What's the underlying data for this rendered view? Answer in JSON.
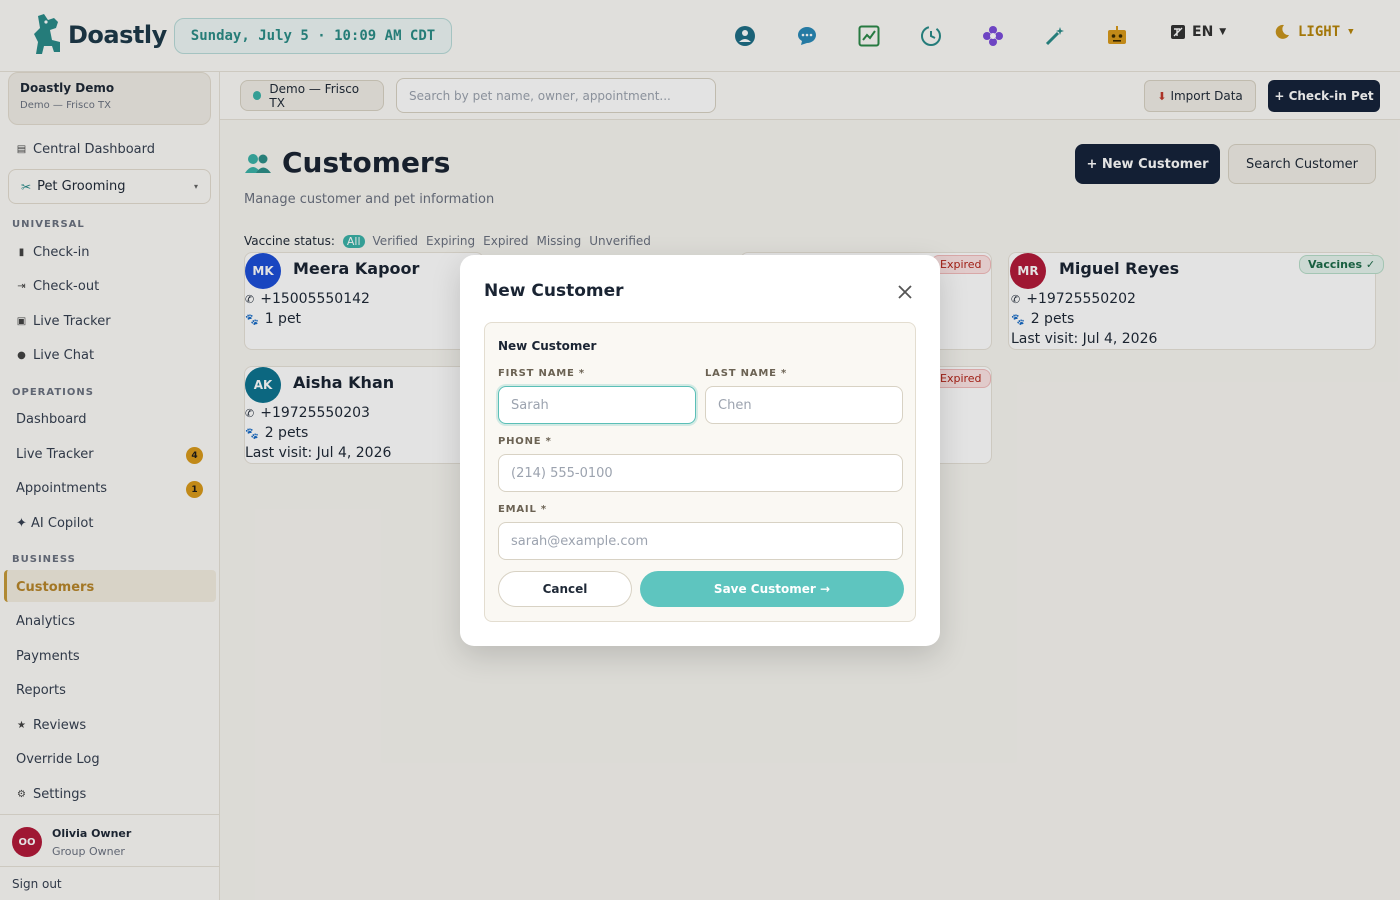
{
  "app": {
    "name": "Doastly"
  },
  "topbar": {
    "datetime": "Sunday, July 5 · 10:09 AM CDT",
    "language": "EN",
    "theme": "LIGHT",
    "icons": [
      "support-icon",
      "chat-icon",
      "analytics-icon",
      "history-icon",
      "flower-icon",
      "magic-wand-icon",
      "robot-icon"
    ]
  },
  "sidebar": {
    "org_name": "Doastly Demo",
    "org_sub": "Demo — Frisco TX",
    "central_dashboard": "Central Dashboard",
    "module": "Pet Grooming",
    "universal_label": "UNIVERSAL",
    "universal": [
      {
        "label": "Check-in"
      },
      {
        "label": "Check-out"
      },
      {
        "label": "Live Tracker"
      },
      {
        "label": "Live Chat"
      }
    ],
    "operations_label": "OPERATIONS",
    "operations": [
      {
        "label": "Dashboard"
      },
      {
        "label": "Live Tracker",
        "badge": "4"
      },
      {
        "label": "Appointments",
        "badge": "1"
      },
      {
        "label": "✦ AI Copilot"
      }
    ],
    "business_label": "BUSINESS",
    "business": [
      {
        "label": "Customers"
      },
      {
        "label": "Analytics"
      },
      {
        "label": "Payments"
      },
      {
        "label": "Reports"
      },
      {
        "label": "Reviews"
      },
      {
        "label": "Override Log"
      },
      {
        "label": "Settings"
      }
    ],
    "user": {
      "initials": "OO",
      "name": "Olivia Owner",
      "role": "Group Owner"
    },
    "sign_out": "Sign out"
  },
  "subbar": {
    "location": "Demo — Frisco TX",
    "search_placeholder": "Search by pet name, owner, appointment...",
    "import_label": "Import Data",
    "checkin_label": "+ Check-in Pet"
  },
  "page": {
    "title": "Customers",
    "subtitle": "Manage customer and pet information",
    "new_customer_label": "+ New Customer",
    "search_customer_label": "Search Customer",
    "vaccine_label": "Vaccine status:",
    "vaccine_filters": [
      "All",
      "Verified",
      "Expiring",
      "Expired",
      "Missing",
      "Unverified"
    ]
  },
  "customers": [
    {
      "initials": "MK",
      "name": "Meera Kapoor",
      "phone": "+15005550142",
      "pets": "1 pet",
      "last_visit": "",
      "color": "#1d4fd8"
    },
    {
      "initials": "AK",
      "name": "Aisha Khan",
      "phone": "+19725550203",
      "pets": "2 pets",
      "last_visit": "Last visit: Jul 4, 2026",
      "color": "#0e7490"
    },
    {
      "initials": "MR",
      "name": "Miguel Reyes",
      "phone": "+19725550202",
      "pets": "2 pets",
      "last_visit": "Last visit: Jul 4, 2026",
      "vaccine": "Vaccines ✓",
      "color": "#b31a3a"
    }
  ],
  "partial_badges": [
    "Expired",
    "Expired"
  ],
  "modal": {
    "title": "New Customer",
    "form_heading": "New Customer",
    "first_name_label": "FIRST NAME *",
    "first_name_placeholder": "Sarah",
    "last_name_label": "LAST NAME *",
    "last_name_placeholder": "Chen",
    "phone_label": "PHONE *",
    "phone_placeholder": "(214) 555-0100",
    "email_label": "EMAIL *",
    "email_placeholder": "sarah@example.com",
    "cancel_label": "Cancel",
    "save_label": "Save Customer →"
  },
  "colors": {
    "primary": "#16233b",
    "accent_teal": "#3bb2a8",
    "save_button": "#5ec5bf",
    "badge_amber": "#d99a1c"
  }
}
